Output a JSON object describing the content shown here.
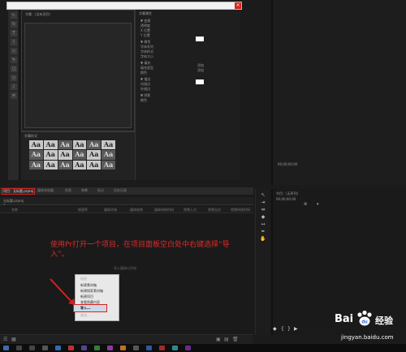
{
  "titler": {
    "close_icon": "×",
    "tabs": {
      "titler": "字幕：(没有项目)",
      "properties": "字幕属性",
      "styles": "字幕样式"
    },
    "style_samples": [
      "Aa",
      "Aa",
      "Aa",
      "Aa",
      "Aa",
      "Aa",
      "Aa",
      "Aa",
      "Aa",
      "Aa",
      "Aa",
      "Aa",
      "Aa",
      "Aa",
      "Aa",
      "Aa",
      "Aa",
      "Aa"
    ],
    "props": [
      "▼ 变换",
      "透明度",
      "X 位置",
      "Y 位置",
      "▼ 属性",
      "字体系列",
      "字体样式",
      "字体大小",
      "▼ 填充",
      "填充类型",
      "颜色",
      "▼ 描边",
      "内描边",
      "外描边",
      "▼ 阴影",
      "颜色"
    ],
    "prop_vals": [
      "添加",
      "添加"
    ]
  },
  "source_monitor": {
    "timecode": "00;00;00;00"
  },
  "tabs": [
    {
      "label": "项目：无标题.prproj",
      "active": true
    },
    {
      "label": "媒体浏览器"
    },
    {
      "label": "信息"
    },
    {
      "label": "效果"
    },
    {
      "label": "标记"
    },
    {
      "label": "历史记录"
    }
  ],
  "project": {
    "filename": "无标题.prproj",
    "columns": [
      "名称",
      "帧速率",
      "媒体开始",
      "媒体结束",
      "媒体持续时间",
      "视频入点",
      "视频出点",
      "视频持续时间"
    ],
    "drop_hint": "导入媒体以开始"
  },
  "annotation": "使用Pr打开一个项目，在项目面板空白处中右键选择“导入”。",
  "context_menu": {
    "items": [
      {
        "label": "粘贴",
        "dim": true
      },
      {
        "label": "新建素材箱"
      },
      {
        "label": "新建搜索素材箱"
      },
      {
        "label": "新建项目"
      },
      {
        "label": "查看隐藏内容"
      },
      {
        "label": "导入..."
      },
      {
        "label": "查找...",
        "dim": true
      }
    ]
  },
  "program_monitor": {
    "title": "节目：(无序列)",
    "timecode": "00;00;00;00"
  },
  "watermark": {
    "brand": "Bai",
    "brand_suffix": "经验",
    "url": "jingyan.baidu.com"
  },
  "colors": {
    "accent_red": "#d92020",
    "annotation_red": "#e02a2a"
  }
}
